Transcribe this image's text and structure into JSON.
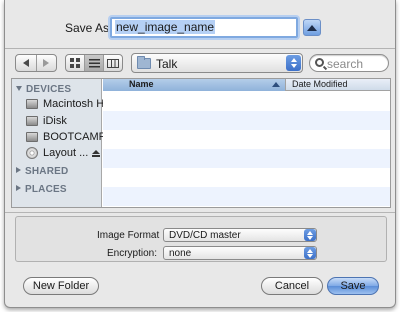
{
  "save_as": {
    "label": "Save As:",
    "filename": "new_image_name"
  },
  "toolbar": {
    "current_folder": "Talk",
    "search_placeholder": "search"
  },
  "sidebar": {
    "devices_header": "DEVICES",
    "devices": [
      {
        "label": "Macintosh HD",
        "icon": "hard-disk-icon"
      },
      {
        "label": "iDisk",
        "icon": "idisk-icon"
      },
      {
        "label": "BOOTCAMP",
        "icon": "hard-disk-icon"
      },
      {
        "label": "Layout ...",
        "icon": "dvd-icon"
      }
    ],
    "shared_header": "SHARED",
    "places_header": "PLACES"
  },
  "file_list": {
    "columns": [
      "Name",
      "Date Modified"
    ],
    "sorted_by": "Name"
  },
  "options": {
    "image_format_label": "Image Format",
    "image_format_value": "DVD/CD master",
    "encryption_label": "Encryption:",
    "encryption_value": "none"
  },
  "buttons": {
    "new_folder": "New Folder",
    "cancel": "Cancel",
    "save": "Save"
  },
  "colors": {
    "accent": "#5b8ed8",
    "sidebar_bg": "#dee4ea",
    "row_alt": "#edf3fe"
  }
}
